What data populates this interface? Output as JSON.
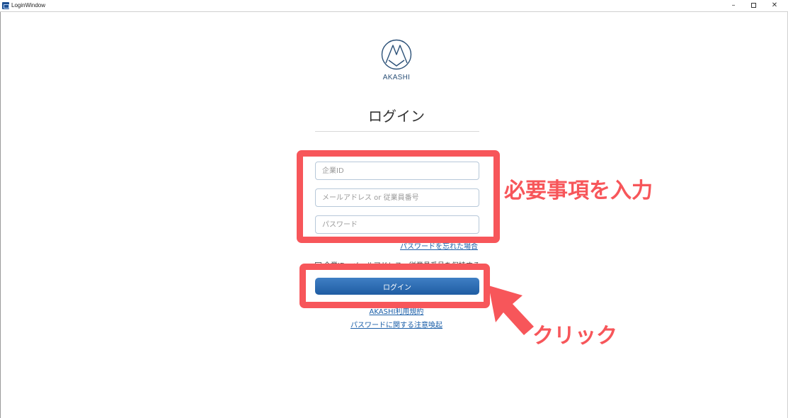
{
  "window": {
    "title": "LoginWindow",
    "minimize": "–",
    "close": "✕"
  },
  "logo": {
    "text": "AKASHI",
    "color": "#2c5178"
  },
  "page": {
    "heading": "ログイン"
  },
  "form": {
    "company_placeholder": "企業ID",
    "email_placeholder": "メールアドレス or 従業員番号",
    "password_placeholder": "パスワード",
    "forgot_link": "パスワードを忘れた場合",
    "remember_label": "企業ID・メールアドレスor従業員番号を保持する",
    "login_button": "ログイン"
  },
  "links": {
    "terms": "AKASHI利用規約",
    "password_notice": "パスワードに関する注意喚起"
  },
  "annotations": {
    "input_note": "必要事項を入力",
    "click_note": "クリック",
    "highlight_color": "#f7565a"
  },
  "colors": {
    "accent": "#2366ad",
    "link": "#1a5ea8"
  }
}
